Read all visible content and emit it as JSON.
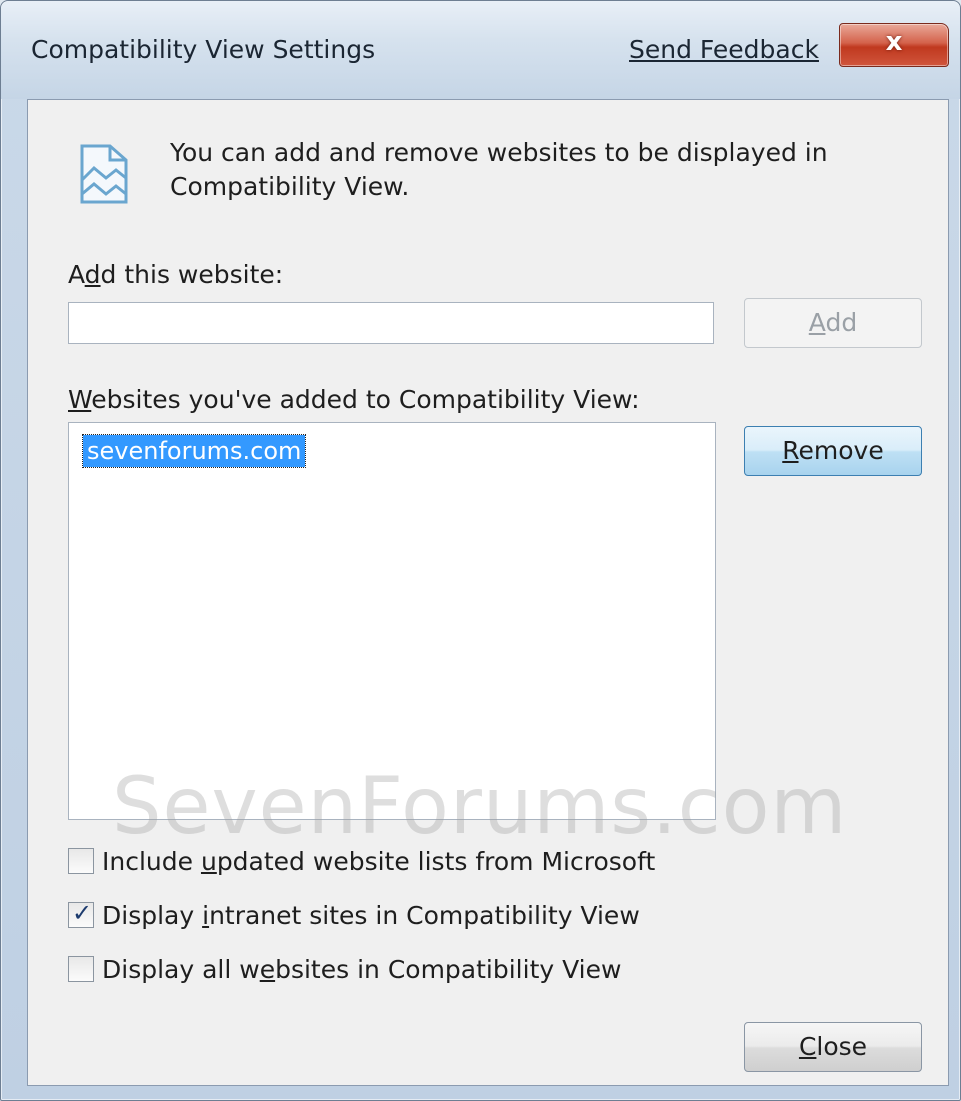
{
  "window": {
    "title": "Compatibility View Settings",
    "feedback_link": "Send Feedback",
    "close_glyph": "x"
  },
  "intro": {
    "text": "You can add and remove websites to be displayed in Compatibility View.",
    "icon": "compatibility-view-icon"
  },
  "add_section": {
    "label_pre": "A",
    "label_accel": "d",
    "label_post": "d this website:",
    "value": "",
    "add_button_accel": "A",
    "add_button_rest": "dd",
    "add_enabled": false
  },
  "list_section": {
    "label_accel": "W",
    "label_rest": "ebsites you've added to Compatibility View:",
    "items": [
      "sevenforums.com"
    ],
    "selected": "sevenforums.com",
    "remove_accel": "R",
    "remove_rest": "emove"
  },
  "watermark": "SevenForums.com",
  "checkboxes": [
    {
      "pre": "Include ",
      "accel": "u",
      "post": "pdated website lists from Microsoft",
      "checked": false
    },
    {
      "pre": "Display ",
      "accel": "i",
      "post": "ntranet sites in Compatibility View",
      "checked": true
    },
    {
      "pre": "Display all w",
      "accel": "e",
      "post": "bsites in Compatibility View",
      "checked": false
    }
  ],
  "footer": {
    "close_accel": "C",
    "close_rest": "lose"
  },
  "colors": {
    "selection": "#3399ff",
    "remove_button_border": "#3c7fb1",
    "close_x_red": "#c0391f"
  }
}
